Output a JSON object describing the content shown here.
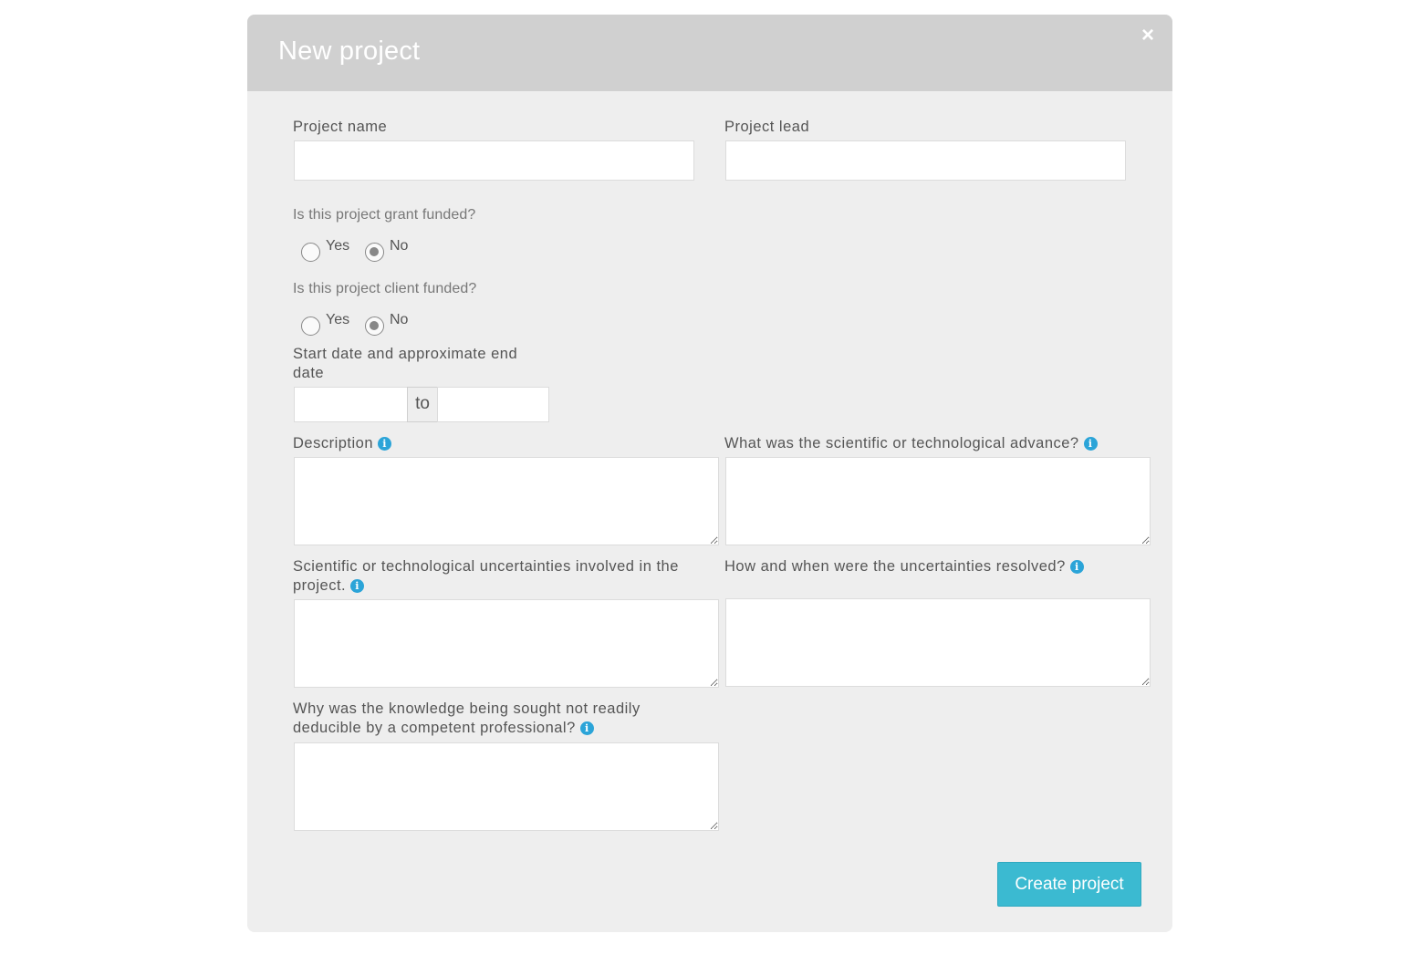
{
  "modal": {
    "title": "New project",
    "close_label": "×"
  },
  "fields": {
    "project_name": {
      "label": "Project name",
      "value": ""
    },
    "project_lead": {
      "label": "Project lead",
      "value": ""
    },
    "grant_funded": {
      "question": "Is this project grant funded?",
      "options": [
        "Yes",
        "No"
      ],
      "selected": "No"
    },
    "client_funded": {
      "question": "Is this project client funded?",
      "options": [
        "Yes",
        "No"
      ],
      "selected": "No"
    },
    "dates": {
      "label_line1": "Start date and approximate end",
      "label_line2": "date",
      "separator": "to",
      "start": "",
      "end": ""
    },
    "description": {
      "label": "Description",
      "value": ""
    },
    "advance": {
      "label": "What was the scientific or technological advance?",
      "value": ""
    },
    "uncertainties": {
      "label_line1": "Scientific or technological uncertainties involved in the",
      "label_line2": "project.",
      "value": ""
    },
    "resolved": {
      "label": "How and when were the uncertainties resolved?",
      "value": ""
    },
    "knowledge": {
      "label_line1": "Why was the knowledge being sought not readily",
      "label_line2": "deducible by a competent professional?",
      "value": ""
    }
  },
  "info_icon_glyph": "i",
  "actions": {
    "create_label": "Create project"
  },
  "colors": {
    "header": "#d0d0d0",
    "accent": "#3bbad1",
    "info": "#2ba4d8"
  }
}
